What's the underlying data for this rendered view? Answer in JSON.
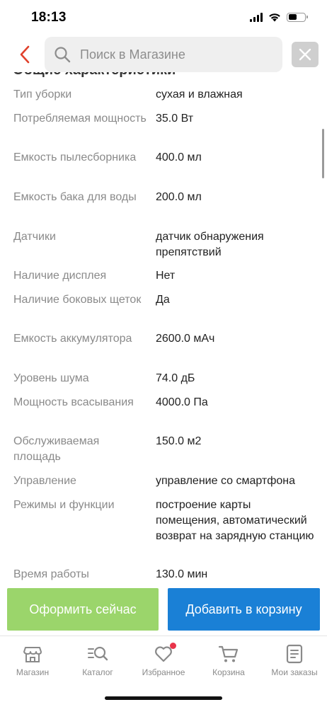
{
  "status_bar": {
    "time": "18:13"
  },
  "search": {
    "placeholder": "Поиск в Магазине"
  },
  "section": {
    "title": "Общие характеристики"
  },
  "specs": [
    {
      "label": "Тип уборки",
      "value": "сухая и влажная"
    },
    {
      "label": "Потребляемая мощность",
      "value": "35.0 Вт"
    },
    {
      "label": "Емкость пылесборника",
      "value": "400.0 мл"
    },
    {
      "label": "Емкость бака для воды",
      "value": "200.0 мл"
    },
    {
      "label": "Датчики",
      "value": "датчик обнаружения препятствий"
    },
    {
      "label": "Наличие дисплея",
      "value": "Нет"
    },
    {
      "label": "Наличие боковых щеток",
      "value": "Да"
    },
    {
      "label": "Емкость аккумулятора",
      "value": "2600.0 мАч"
    },
    {
      "label": "Уровень шума",
      "value": "74.0 дБ"
    },
    {
      "label": "Мощность всасывания",
      "value": "4000.0 Па"
    },
    {
      "label": "Обслуживаемая площадь",
      "value": "150.0 м2"
    },
    {
      "label": "Управление",
      "value": "управление со смартфона"
    },
    {
      "label": "Режимы и функции",
      "value": "построение карты помещения, автоматический возврат на зарядную станцию"
    },
    {
      "label": "Время работы",
      "value": "130.0 мин"
    }
  ],
  "actions": {
    "order_label": "Оформить сейчас",
    "cart_label": "Добавить в корзину"
  },
  "tabs": [
    {
      "label": "Магазин",
      "icon": "store-icon"
    },
    {
      "label": "Каталог",
      "icon": "catalog-search-icon"
    },
    {
      "label": "Избранное",
      "icon": "heart-icon",
      "badge": true
    },
    {
      "label": "Корзина",
      "icon": "cart-icon"
    },
    {
      "label": "Мои заказы",
      "icon": "orders-icon"
    }
  ],
  "colors": {
    "accent_red": "#e0412c",
    "order_green": "#9bd56b",
    "cart_blue": "#1a80d6",
    "badge_red": "#e8344a"
  }
}
